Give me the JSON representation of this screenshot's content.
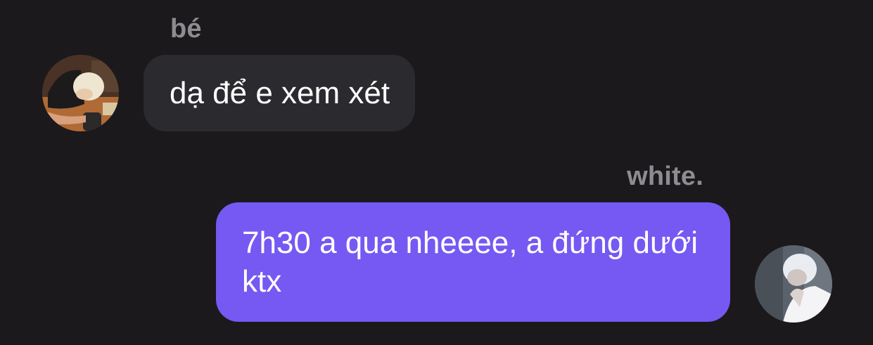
{
  "conversation": {
    "received": {
      "sender": "bé",
      "avatar_icon": "profile-photo-icon",
      "text": "dạ để e xem xét"
    },
    "sent": {
      "sender": "white.",
      "avatar_icon": "profile-photo-icon",
      "text": "7h30 a qua nheeee, a đứng dưới ktx"
    }
  },
  "colors": {
    "background": "#1b191c",
    "received_bubble": "#2b2a2e",
    "sent_bubble": "#7559f2",
    "sender_name": "#8e8c91",
    "message_text": "#ffffff"
  }
}
